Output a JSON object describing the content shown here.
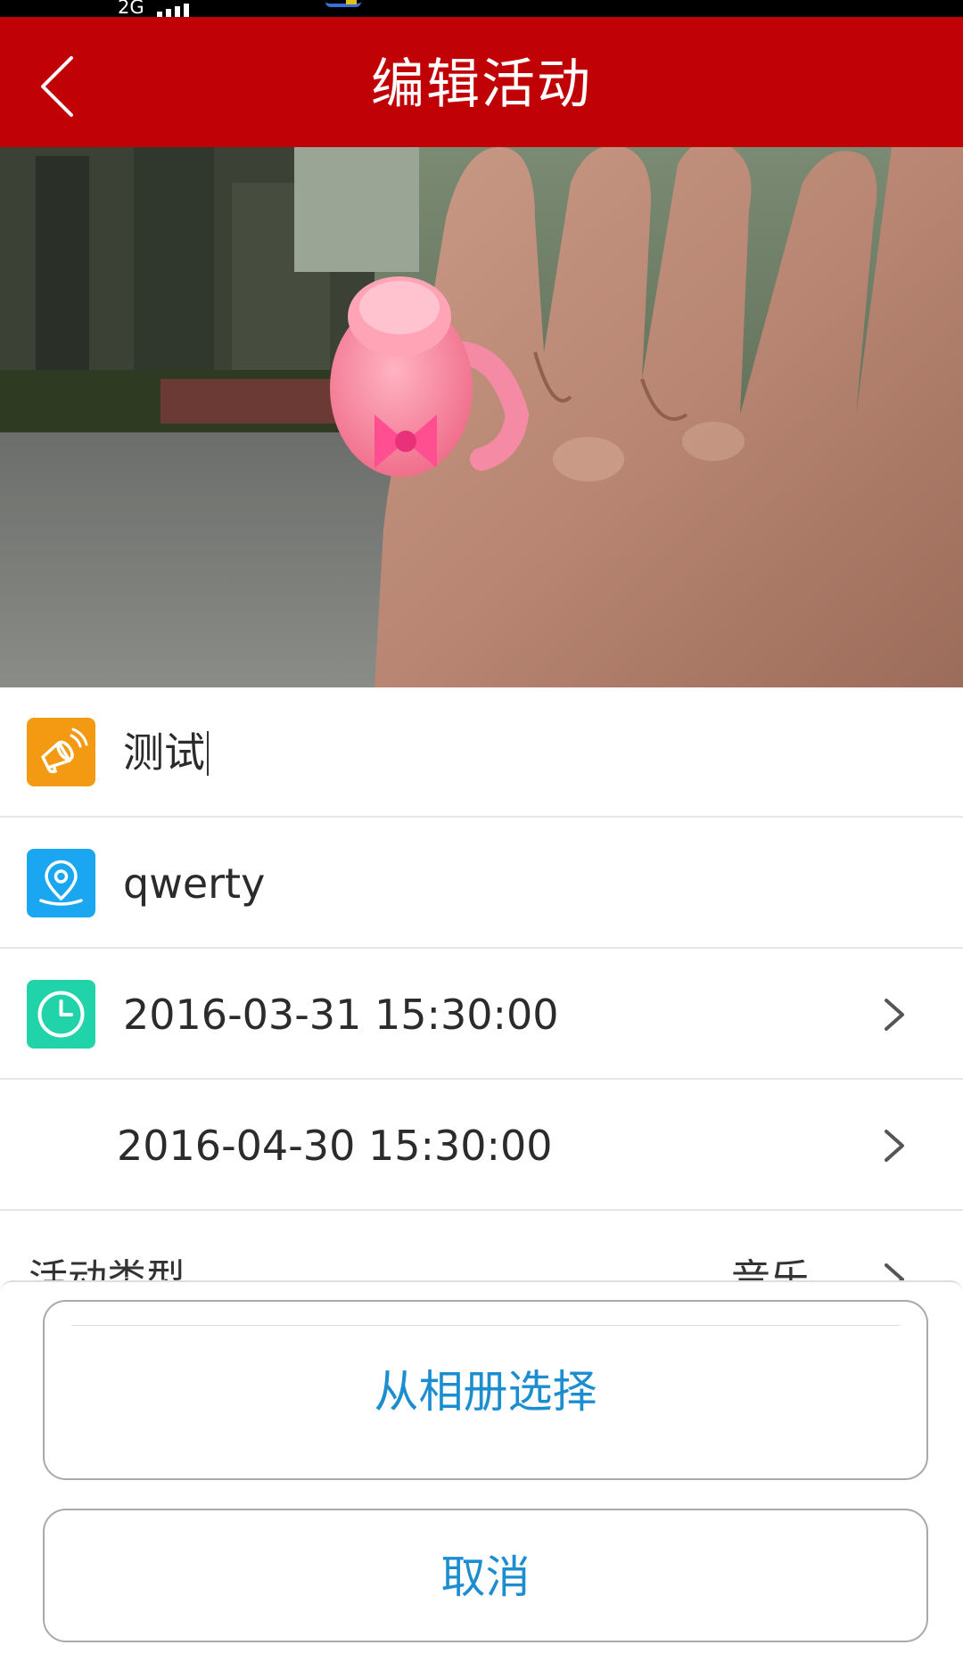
{
  "status_bar": {
    "network": "2G"
  },
  "header": {
    "title": "编辑活动"
  },
  "form": {
    "name_value": "测试",
    "location_value": "qwerty",
    "start_time": "2016-03-31 15:30:00",
    "end_time": "2016-04-30 15:30:00",
    "type_label": "活动类型",
    "type_value": "音乐"
  },
  "action_sheet": {
    "choose_album_label": "从相册选择",
    "cancel_label": "取消"
  },
  "icons": {
    "name": "megaphone-icon",
    "location": "location-pin-icon",
    "time": "clock-icon",
    "back": "chevron-left-icon",
    "row_arrow": "chevron-right-icon"
  },
  "colors": {
    "header_red": "#c00106",
    "name_icon_bg": "#f39a12",
    "location_icon_bg": "#1aa6f0",
    "time_icon_bg": "#20d3a8",
    "sheet_text_blue": "#1c8ed0"
  }
}
